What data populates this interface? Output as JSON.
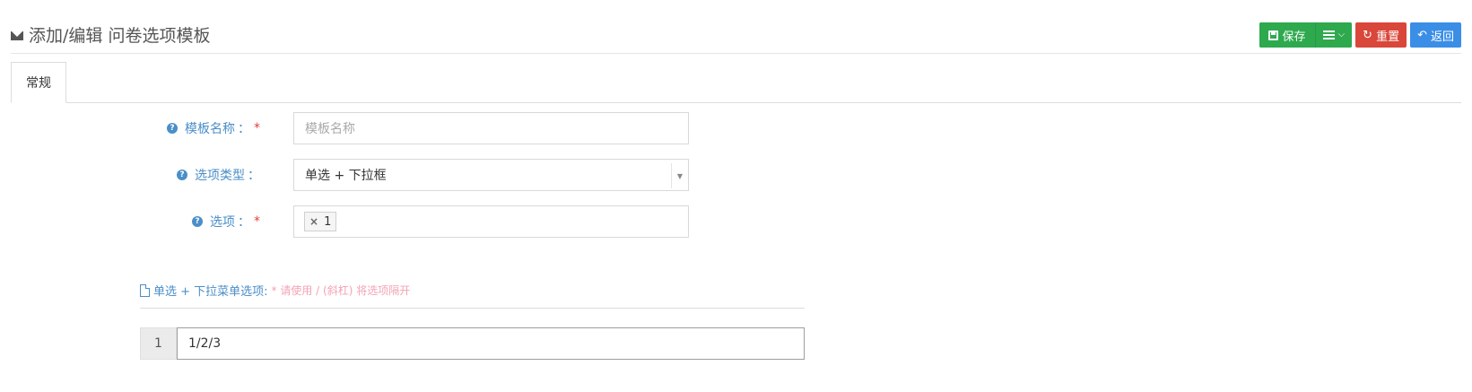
{
  "header": {
    "title": "添加/编辑 问卷选项模板",
    "title_icon": "envelope-icon"
  },
  "toolbar": {
    "save_label": "保存",
    "reset_label": "重置",
    "back_label": "返回",
    "save_color": "#2ea94e",
    "reset_color": "#d9463a",
    "back_color": "#3a8ee6"
  },
  "tabs": [
    {
      "label": "常规",
      "active": true
    }
  ],
  "form": {
    "template_name": {
      "label": "模板名称",
      "colon": "：",
      "required": "*",
      "placeholder": "模板名称",
      "value": ""
    },
    "option_type": {
      "label": "选项类型",
      "colon": "：",
      "value": "单选 + 下拉框"
    },
    "options": {
      "label": "选项",
      "colon": "：",
      "required": "*",
      "tags": [
        "1"
      ]
    }
  },
  "section": {
    "title": "单选 + 下拉菜单选项:",
    "hint": "* 请使用 / (斜杠) 将选项隔开"
  },
  "option_rows": [
    {
      "index": "1",
      "value": "1/2/3"
    }
  ]
}
